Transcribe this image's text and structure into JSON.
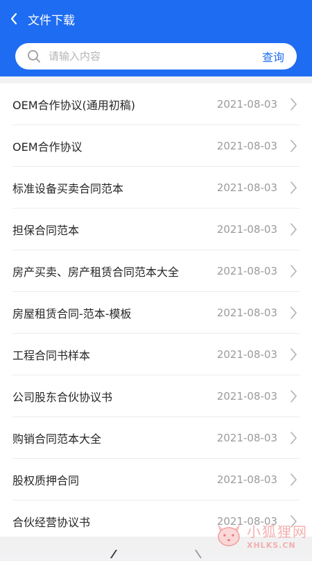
{
  "header": {
    "title": "文件下载",
    "bg_color": "#1e6cf2"
  },
  "search": {
    "placeholder": "请输入内容",
    "button_label": "查询"
  },
  "files": [
    {
      "name": "OEM合作协议(通用初稿)",
      "date": "2021-08-03"
    },
    {
      "name": "OEM合作协议",
      "date": "2021-08-03"
    },
    {
      "name": "标准设备买卖合同范本",
      "date": "2021-08-03"
    },
    {
      "name": "担保合同范本",
      "date": "2021-08-03"
    },
    {
      "name": "房产买卖、房产租赁合同范本大全",
      "date": "2021-08-03"
    },
    {
      "name": "房屋租赁合同-范本-模板",
      "date": "2021-08-03"
    },
    {
      "name": "工程合同书样本",
      "date": "2021-08-03"
    },
    {
      "name": "公司股东合伙协议书",
      "date": "2021-08-03"
    },
    {
      "name": "购销合同范本大全",
      "date": "2021-08-03"
    },
    {
      "name": "股权质押合同",
      "date": "2021-08-03"
    },
    {
      "name": "合伙经营协议书",
      "date": "2021-08-03"
    }
  ],
  "watermark": {
    "text_cn": "小狐狸网",
    "text_en": "XHLKS.CN"
  },
  "icons": {
    "back": "chevron-left-icon",
    "search": "search-icon",
    "row_arrow": "chevron-right-icon"
  }
}
